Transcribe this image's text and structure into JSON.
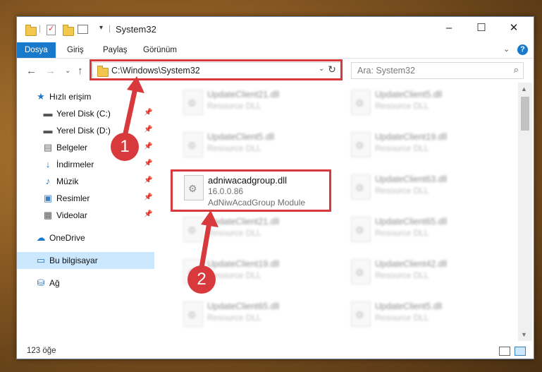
{
  "window": {
    "title": "System32"
  },
  "window_controls": {
    "minimize": "–",
    "maximize": "☐",
    "close": "✕"
  },
  "ribbon": {
    "tabs": [
      "Dosya",
      "Giriş",
      "Paylaş",
      "Görünüm"
    ],
    "help": "?"
  },
  "address": {
    "path": "C:\\Windows\\System32",
    "refresh": "↻"
  },
  "search": {
    "placeholder": "Ara: System32",
    "icon": "⌕"
  },
  "sidebar": {
    "items": [
      {
        "label": "Hızlı erişim",
        "icon": "star-icon"
      },
      {
        "label": "Yerel Disk (C:)",
        "icon": "drive-icon"
      },
      {
        "label": "Yerel Disk (D:)",
        "icon": "drive-icon"
      },
      {
        "label": "Belgeler",
        "icon": "documents-icon"
      },
      {
        "label": "İndirmeler",
        "icon": "download-icon"
      },
      {
        "label": "Müzik",
        "icon": "music-icon"
      },
      {
        "label": "Resimler",
        "icon": "pictures-icon"
      },
      {
        "label": "Videolar",
        "icon": "video-icon"
      },
      {
        "label": "OneDrive",
        "icon": "cloud-icon"
      },
      {
        "label": "Bu bilgisayar",
        "icon": "computer-icon"
      },
      {
        "label": "Ağ",
        "icon": "network-icon"
      }
    ]
  },
  "files": [
    {
      "name": "UpdateClient21.dll",
      "desc": "Resource DLL"
    },
    {
      "name": "UpdateClient5.dll",
      "desc": "Resource DLL"
    },
    {
      "name": "UpdateClient5.dll",
      "desc": "Resource DLL"
    },
    {
      "name": "UpdateClient19.dll",
      "desc": "Resource DLL"
    },
    {
      "name": "adniwacadgroup.dll",
      "version": "16.0.0.86",
      "desc": "AdNiwAcadGroup Module"
    },
    {
      "name": "UpdateClient63.dll",
      "desc": "Resource DLL"
    },
    {
      "name": "UpdateClient21.dll",
      "desc": "Resource DLL"
    },
    {
      "name": "UpdateClient65.dll",
      "desc": "Resource DLL"
    },
    {
      "name": "UpdateClient19.dll",
      "desc": "Resource DLL"
    },
    {
      "name": "UpdateClient42.dll",
      "desc": "Resource DLL"
    },
    {
      "name": "UpdateClient65.dll",
      "desc": "Resource DLL"
    },
    {
      "name": "UpdateClient5.dll",
      "desc": "Resource DLL"
    }
  ],
  "status": {
    "count": "123 öğe"
  },
  "annotations": {
    "step1": "1",
    "step2": "2",
    "color": "#d7393c"
  },
  "colors": {
    "accent": "#1979ca",
    "selected": "#cce8ff"
  }
}
